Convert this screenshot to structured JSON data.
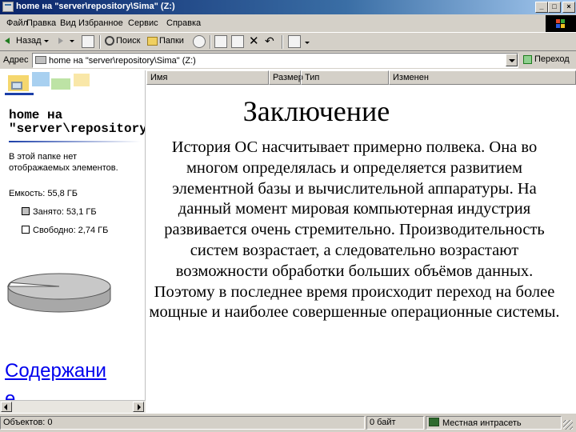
{
  "window": {
    "title": "home на \"server\\repository\\Sima\" (Z:)",
    "buttons": {
      "minimize": "_",
      "maximize": "□",
      "close": "×"
    }
  },
  "menu": [
    "Файл",
    "Правка",
    "Вид",
    "Избранное",
    "Сервис",
    "Справка"
  ],
  "toolbar": {
    "back": "Назад",
    "search": "Поиск",
    "folders": "Папки"
  },
  "address": {
    "label": "Адрес",
    "value": "home на \"server\\repository\\Sima\" (Z:)",
    "go": "Переход"
  },
  "left_panel": {
    "heading": "home на\n\"server\\repository\\Sima\" (Z:)",
    "note": "В этой папке нет отображаемых элементов.",
    "capacity": "Емкость: 55,8 ГБ",
    "used": "Занято: 53,1 ГБ",
    "free": "Свободно: 2,74 ГБ",
    "used_color": "#c0c0c0",
    "free_color": "#ffffff",
    "free_fraction": 0.049
  },
  "columns": [
    "Имя",
    "Размер",
    "Тип",
    "Изменен"
  ],
  "slide": {
    "title": "Заключение",
    "body": "История ОС насчитывает примерно полвека. Она во многом определялась и определяется развитием элементной базы и вычислительной аппаратуры. На данный момент мировая компьютерная индустрия развивается очень стремительно. Производительность систем возрастает, а следовательно возрастают возможности обработки больших объёмов данных. Поэтому в последнее время происходит переход на более мощные и наиболее совершенные операционные системы.",
    "link": "Содержание"
  },
  "status": {
    "objects": "Объектов: 0",
    "size": "0 байт",
    "zone": "Местная интрасеть"
  }
}
